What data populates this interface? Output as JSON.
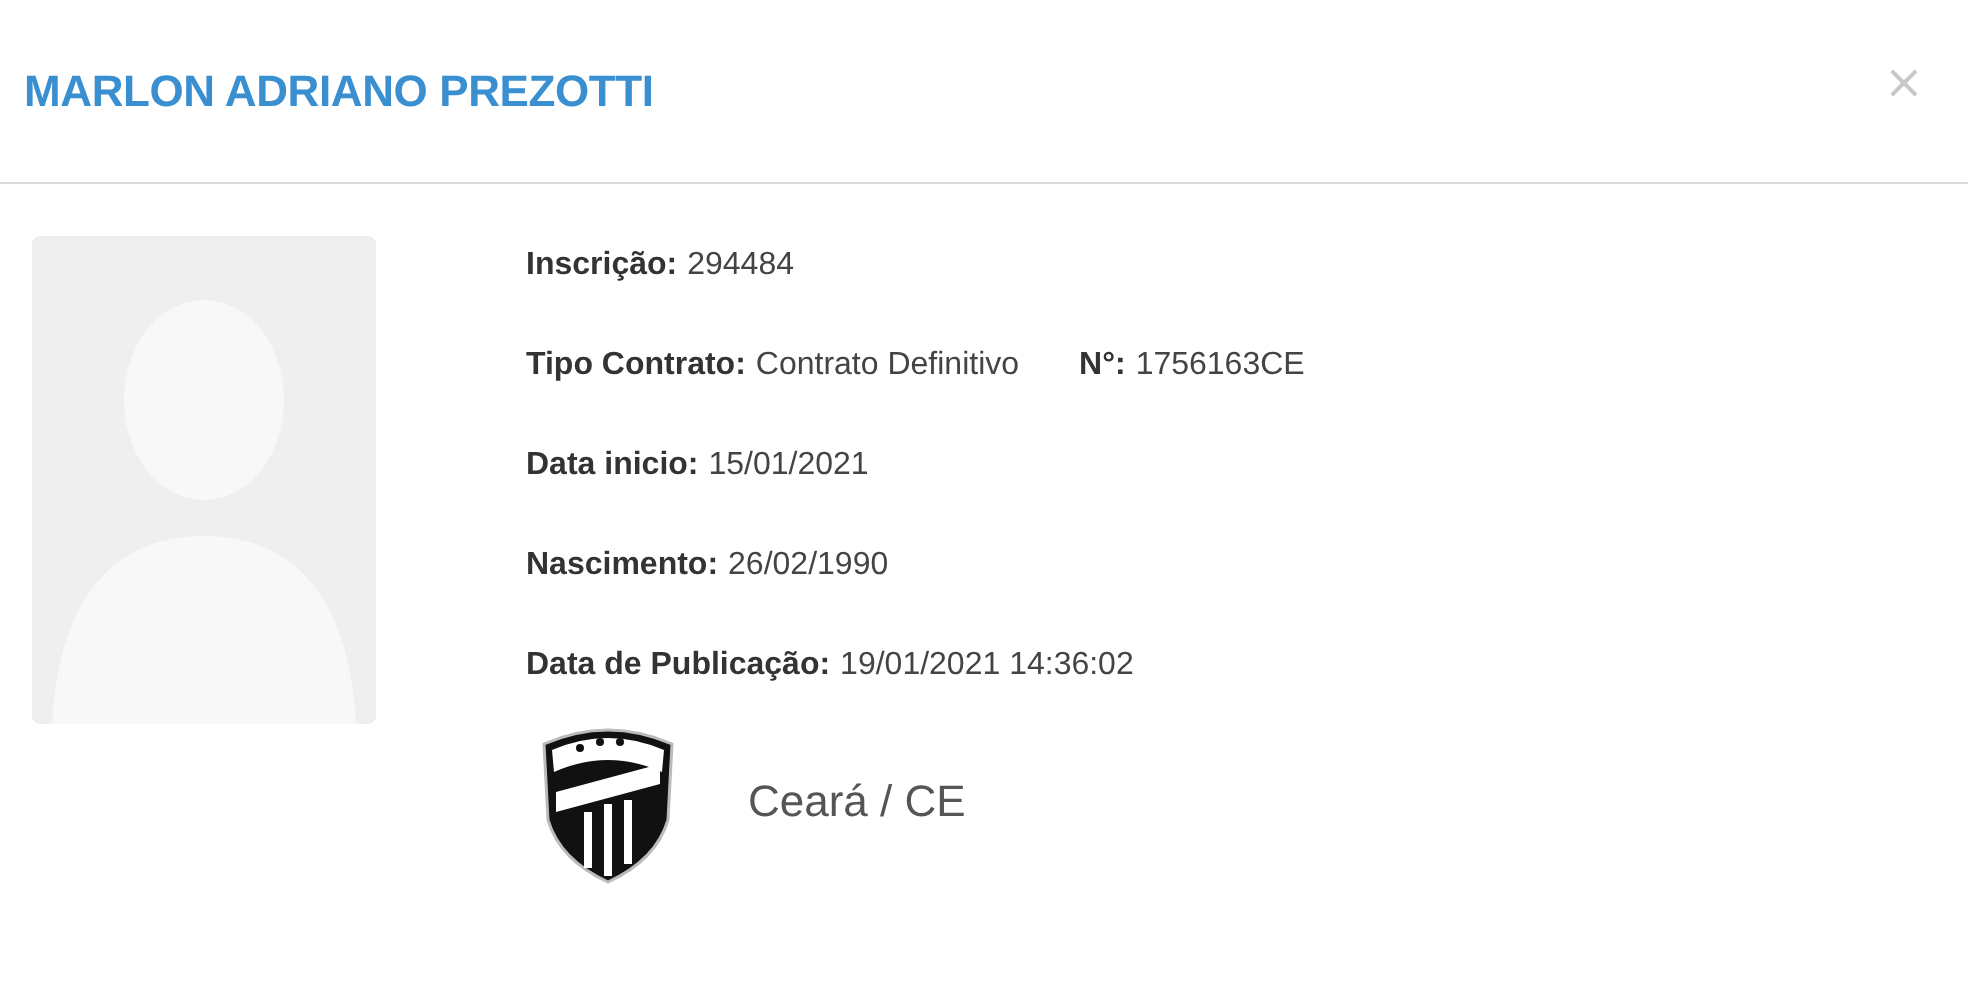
{
  "dialog": {
    "title": "MARLON ADRIANO PREZOTTI",
    "close": "×"
  },
  "details": [
    {
      "fields": [
        {
          "label": "Inscrição:",
          "value": "294484"
        }
      ]
    },
    {
      "fields": [
        {
          "label": "Tipo Contrato:",
          "value": "Contrato Definitivo"
        },
        {
          "label": "N°:",
          "value": "1756163CE"
        }
      ]
    },
    {
      "fields": [
        {
          "label": "Data inicio:",
          "value": "15/01/2021"
        }
      ]
    },
    {
      "fields": [
        {
          "label": "Nascimento:",
          "value": "26/02/1990"
        }
      ]
    },
    {
      "fields": [
        {
          "label": "Data de Publicação:",
          "value": "19/01/2021 14:36:02"
        }
      ]
    }
  ],
  "club": {
    "name": "Ceará / CE"
  }
}
